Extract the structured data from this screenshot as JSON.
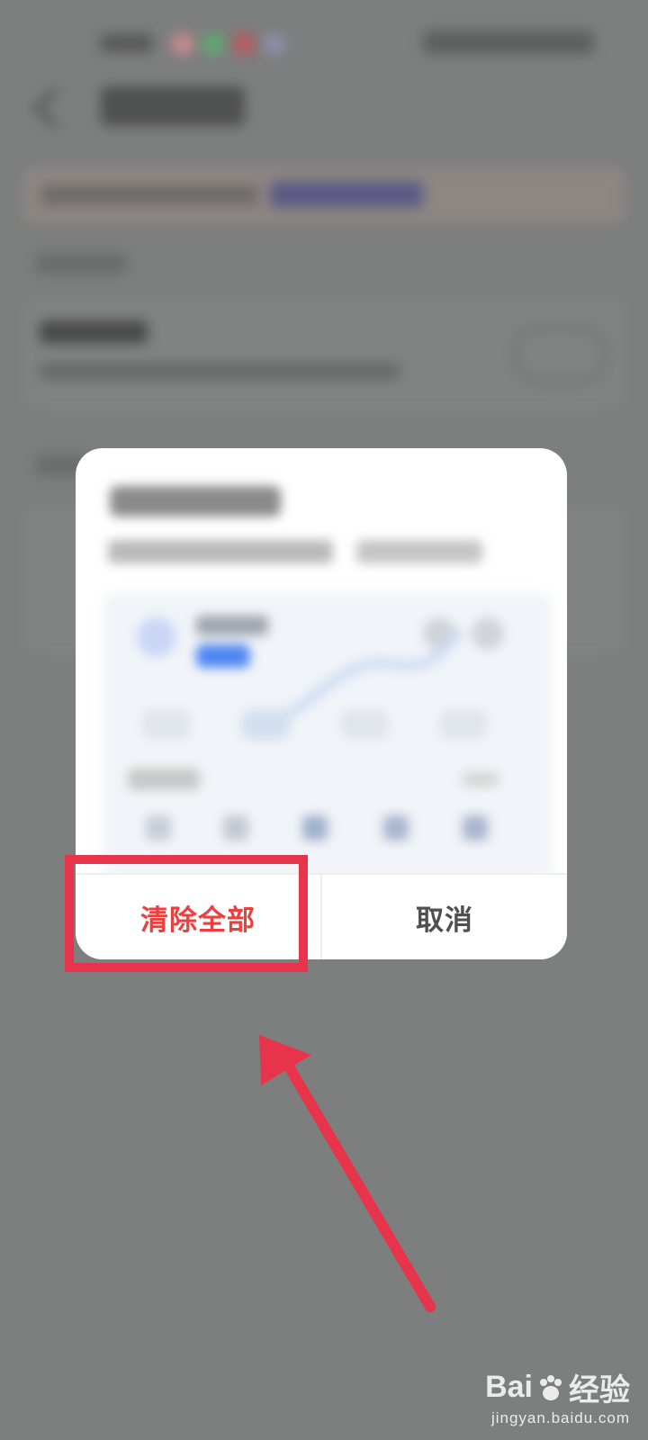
{
  "dialog": {
    "clear_all_label": "清除全部",
    "cancel_label": "取消"
  },
  "colors": {
    "overlay": "#7d7e7e",
    "dialog_bg": "#ffffff",
    "destructive_text": "#e9413f",
    "cancel_text": "#4f4f4f",
    "annotation_red": "#e8344a"
  },
  "watermark": {
    "brand": "Bai",
    "brand_suffix": "经验",
    "url": "jingyan.baidu.com"
  }
}
